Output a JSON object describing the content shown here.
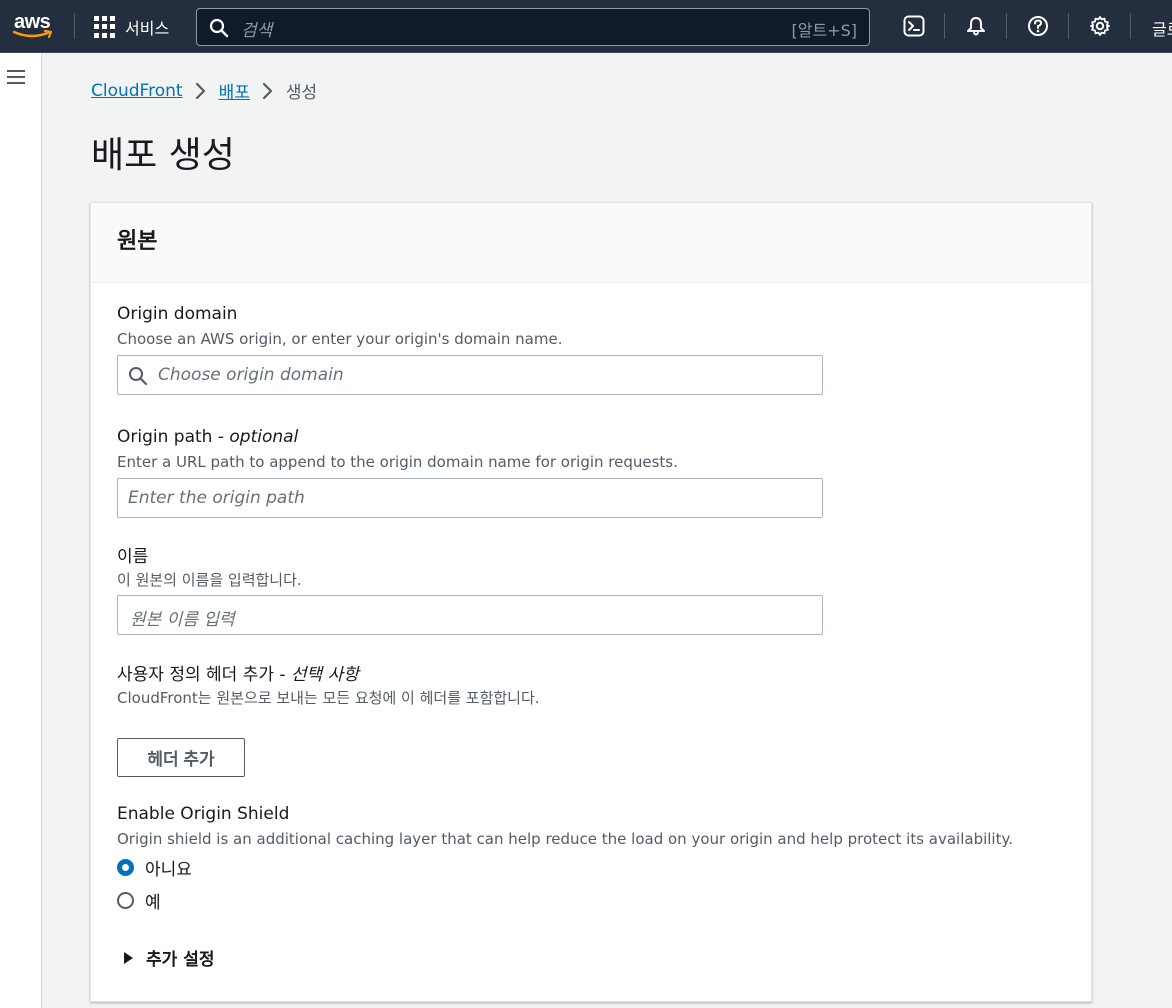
{
  "topnav": {
    "logo_text": "aws",
    "services_label": "서비스",
    "search_placeholder": "검색",
    "search_shortcut": "[알트+S]",
    "language_label": "글로벌"
  },
  "icons": {
    "grid": "grid-icon",
    "search": "search-icon",
    "cloudshell": "cloudshell-icon",
    "notifications": "bell-icon",
    "help": "help-icon",
    "settings": "gear-icon",
    "menu": "hamburger-menu-icon"
  },
  "breadcrumb": {
    "items": [
      "CloudFront",
      "배포",
      "생성"
    ]
  },
  "page": {
    "title": "배포 생성"
  },
  "panel": {
    "title": "원본",
    "origin_domain": {
      "label": "Origin domain",
      "description": "Choose an AWS origin, or enter your origin's domain name.",
      "placeholder": "Choose origin domain",
      "value": ""
    },
    "origin_path": {
      "label": "Origin path - ",
      "label_optional": "optional",
      "description": "Enter a URL path to append to the origin domain name for origin requests.",
      "placeholder": "Enter the origin path",
      "value": ""
    },
    "name": {
      "label": "이름",
      "description": "이 원본의 이름을 입력합니다.",
      "placeholder": "원본 이름 입력",
      "value": ""
    },
    "custom_headers": {
      "label": "사용자 정의 헤더 추가 - ",
      "label_optional": "선택 사항",
      "description": "CloudFront는 원본으로 보내는 모든 요청에 이 헤더를 포함합니다.",
      "button_label": "헤더 추가"
    },
    "origin_shield": {
      "label": "Enable Origin Shield",
      "description": "Origin shield is an additional caching layer that can help reduce the load on your origin and help protect its availability.",
      "options": [
        "아니요",
        "예"
      ],
      "selected": "아니요"
    },
    "additional_settings_label": "추가 설정"
  },
  "colors": {
    "nav_bg": "#232f3e",
    "link": "#0073bb",
    "radio_selected": "#0073bb",
    "page_bg": "#f2f3f3"
  }
}
